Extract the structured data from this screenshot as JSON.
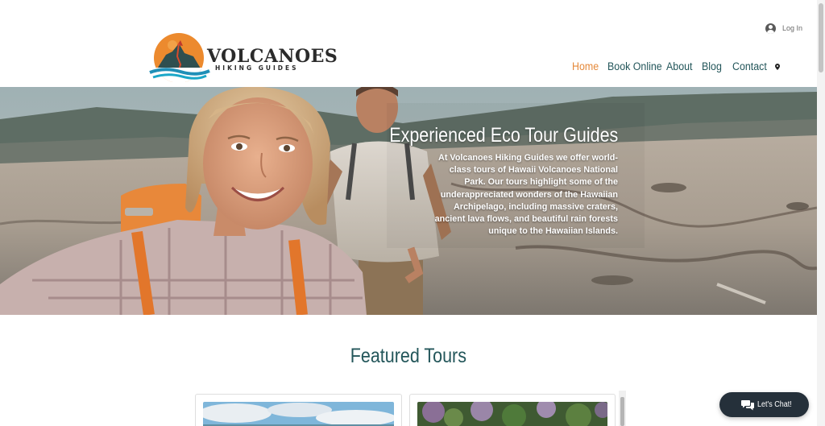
{
  "brand": {
    "name": "VOLCANOES",
    "tagline": "HIKING GUIDES",
    "colors": {
      "orange": "#e5893a",
      "teal": "#23565a",
      "dark": "#2b2b2b"
    }
  },
  "header": {
    "login_label": "Log In",
    "nav": [
      {
        "label": "Home",
        "active": true
      },
      {
        "label": "Book Online",
        "active": false
      },
      {
        "label": "About",
        "active": false
      },
      {
        "label": "Blog",
        "active": false
      },
      {
        "label": "Contact",
        "active": false
      }
    ],
    "location_icon": "map-pin-icon"
  },
  "hero": {
    "title": "Experienced Eco Tour Guides",
    "lines": [
      "At Volcanoes Hiking Guides we offer world-",
      "class tours of Hawaii Volcanoes National",
      "Park. Our tours highlight some of the",
      "underappreciated wonders of the Hawaiian",
      "Archipelago, including massive craters,",
      "ancient lava flows, and beautiful rain forests",
      "unique to the Hawaiian Islands."
    ]
  },
  "featured": {
    "title": "Featured Tours",
    "cards": [
      {
        "image": "sky-and-ocean-landscape"
      },
      {
        "image": "rainforest-foliage"
      }
    ]
  },
  "chat": {
    "label": "Let's Chat!",
    "icon": "chat-bubbles-icon"
  }
}
